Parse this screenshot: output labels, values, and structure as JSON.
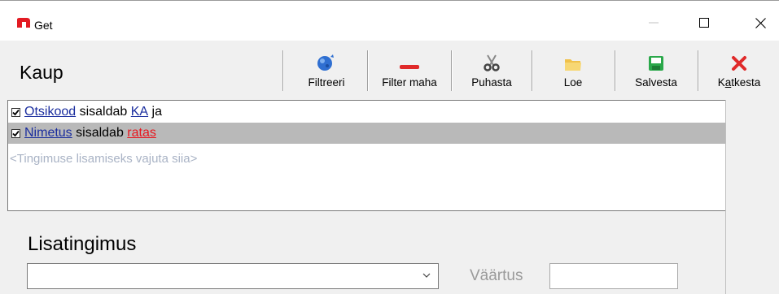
{
  "window": {
    "title": "Get",
    "minimize_label": "—",
    "maximize_label": "☐",
    "close_label": "✕"
  },
  "toolbar": {
    "title": "Kaup",
    "buttons": [
      {
        "label": "Filtreeri",
        "icon": "globe-icon"
      },
      {
        "label": "Filter maha",
        "icon": "minus-icon"
      },
      {
        "label": "Puhasta",
        "icon": "scissors-icon"
      },
      {
        "label": "Loe",
        "icon": "folder-icon"
      },
      {
        "label": "Salvesta",
        "icon": "save-icon"
      },
      {
        "label": "Katkesta",
        "icon": "cancel-icon",
        "accel_prefix": "K",
        "accel_char": "a",
        "accel_suffix": "tkesta"
      }
    ]
  },
  "conditions": [
    {
      "checked": true,
      "field": "Otsikood",
      "op": "sisaldab",
      "value": "KA",
      "joiner": "ja",
      "selected": false
    },
    {
      "checked": true,
      "field": "Nimetus",
      "op": "sisaldab",
      "value": "ratas",
      "joiner": "",
      "selected": true
    }
  ],
  "add_hint": "<Tingimuse lisamiseks vajuta siia>",
  "extra": {
    "title": "Lisatingimus",
    "combo_value": "",
    "value_label": "Väärtus",
    "value_input": ""
  },
  "colors": {
    "link": "#1a2d9e",
    "value_red": "#e8161e",
    "selected_row": "#b9b9b9",
    "hint": "#a9b3c5"
  }
}
